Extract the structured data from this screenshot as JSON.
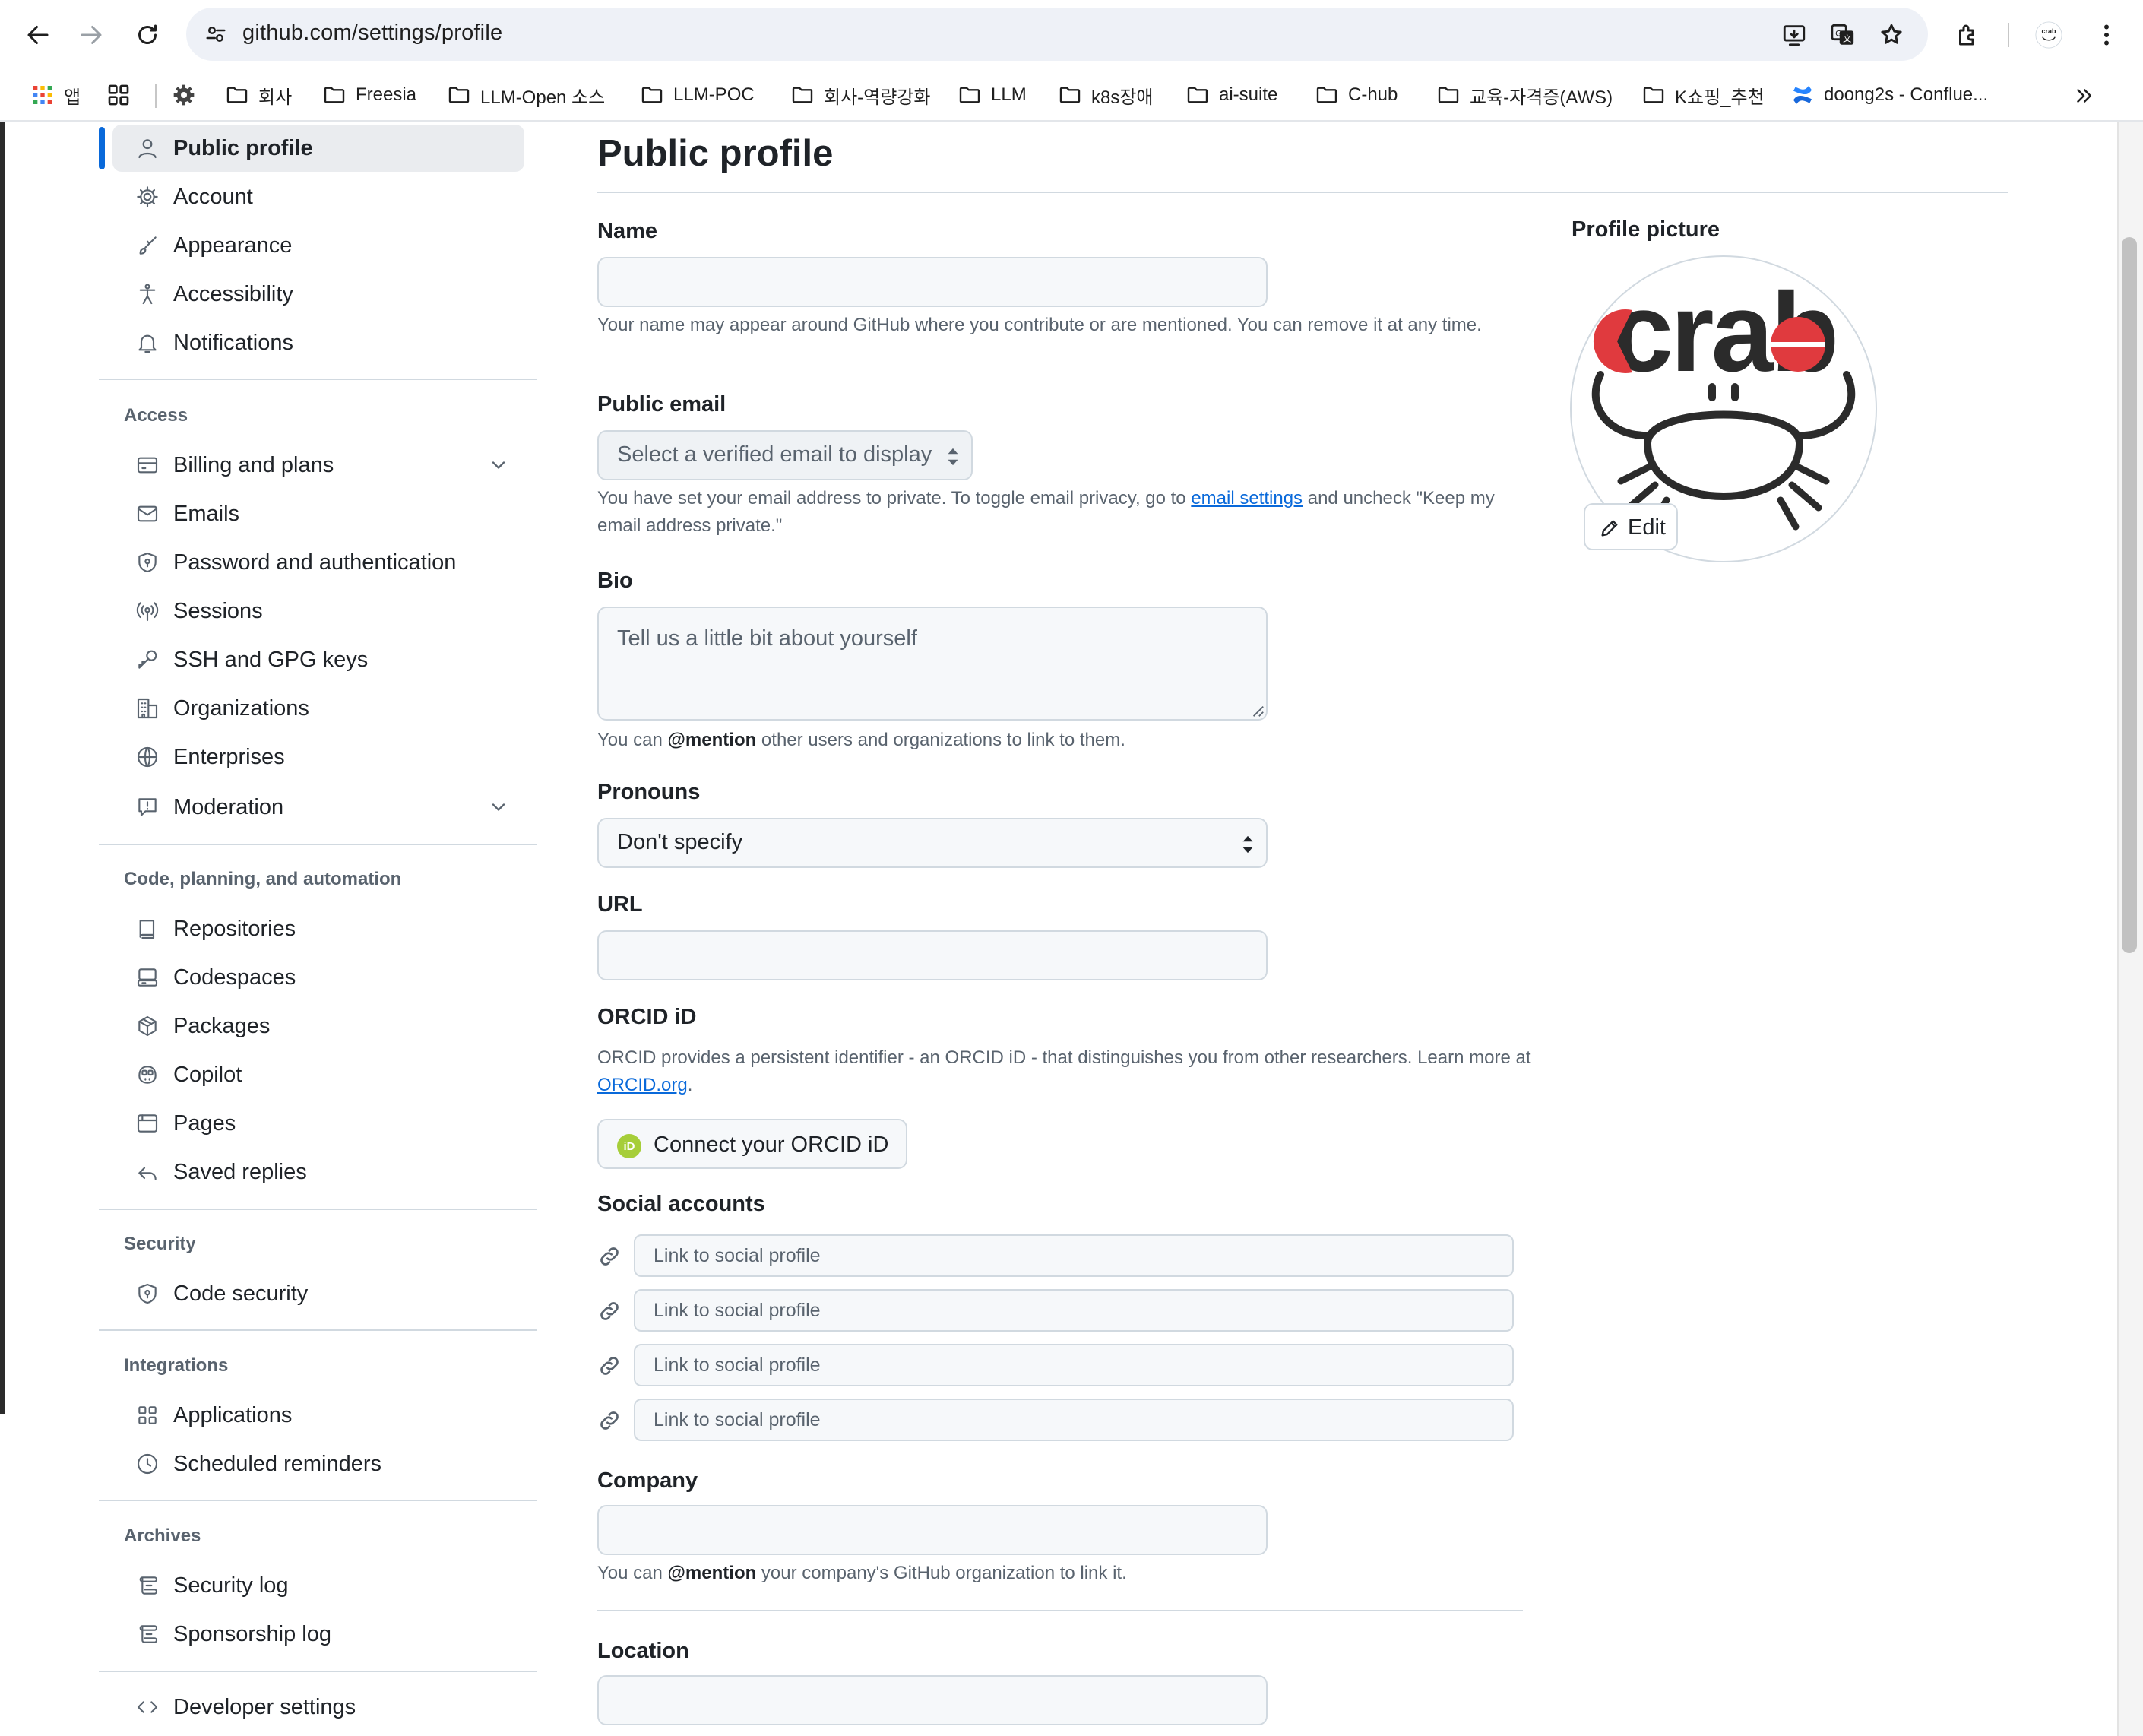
{
  "browser": {
    "url": "github.com/settings/profile",
    "bookmarks": [
      {
        "label": "앱",
        "icon": "apps-grid-icon"
      },
      {
        "label": "",
        "icon": "tab-groups-icon"
      },
      {
        "label": "",
        "icon": "gear-icon"
      },
      {
        "label": "회사",
        "icon": "folder-icon"
      },
      {
        "label": "Freesia",
        "icon": "folder-icon"
      },
      {
        "label": "LLM-Open 소스",
        "icon": "folder-icon"
      },
      {
        "label": "LLM-POC",
        "icon": "folder-icon"
      },
      {
        "label": "회사-역량강화",
        "icon": "folder-icon"
      },
      {
        "label": "LLM",
        "icon": "folder-icon"
      },
      {
        "label": "k8s장애",
        "icon": "folder-icon"
      },
      {
        "label": "ai-suite",
        "icon": "folder-icon"
      },
      {
        "label": "C-hub",
        "icon": "folder-icon"
      },
      {
        "label": "교육-자격증(AWS)",
        "icon": "folder-icon"
      },
      {
        "label": "K쇼핑_추천",
        "icon": "folder-icon"
      },
      {
        "label": "doong2s - Conflue...",
        "icon": "confluence-icon"
      }
    ]
  },
  "sidebar": {
    "top_items": [
      {
        "label": "Public profile",
        "icon": "person-icon",
        "active": true
      },
      {
        "label": "Account",
        "icon": "gear-icon"
      },
      {
        "label": "Appearance",
        "icon": "paintbrush-icon"
      },
      {
        "label": "Accessibility",
        "icon": "accessibility-icon"
      },
      {
        "label": "Notifications",
        "icon": "bell-icon"
      }
    ],
    "sections": [
      {
        "heading": "Access",
        "items": [
          {
            "label": "Billing and plans",
            "icon": "credit-card-icon",
            "expandable": true
          },
          {
            "label": "Emails",
            "icon": "mail-icon"
          },
          {
            "label": "Password and authentication",
            "icon": "shield-lock-icon"
          },
          {
            "label": "Sessions",
            "icon": "broadcast-icon"
          },
          {
            "label": "SSH and GPG keys",
            "icon": "key-icon"
          },
          {
            "label": "Organizations",
            "icon": "organization-icon"
          },
          {
            "label": "Enterprises",
            "icon": "globe-icon"
          },
          {
            "label": "Moderation",
            "icon": "report-icon",
            "expandable": true
          }
        ]
      },
      {
        "heading": "Code, planning, and automation",
        "items": [
          {
            "label": "Repositories",
            "icon": "repo-icon"
          },
          {
            "label": "Codespaces",
            "icon": "codespaces-icon"
          },
          {
            "label": "Packages",
            "icon": "package-icon"
          },
          {
            "label": "Copilot",
            "icon": "copilot-icon"
          },
          {
            "label": "Pages",
            "icon": "browser-icon"
          },
          {
            "label": "Saved replies",
            "icon": "reply-icon"
          }
        ]
      },
      {
        "heading": "Security",
        "items": [
          {
            "label": "Code security",
            "icon": "shield-lock-icon"
          }
        ]
      },
      {
        "heading": "Integrations",
        "items": [
          {
            "label": "Applications",
            "icon": "apps-icon"
          },
          {
            "label": "Scheduled reminders",
            "icon": "clock-icon"
          }
        ]
      },
      {
        "heading": "Archives",
        "items": [
          {
            "label": "Security log",
            "icon": "log-icon"
          },
          {
            "label": "Sponsorship log",
            "icon": "log-icon"
          }
        ]
      }
    ],
    "bottom_item": {
      "label": "Developer settings",
      "icon": "code-icon"
    }
  },
  "main": {
    "title": "Public profile",
    "name": {
      "label": "Name",
      "value": "",
      "note": "Your name may appear around GitHub where you contribute or are mentioned. You can remove it at any time."
    },
    "public_email": {
      "label": "Public email",
      "selected": "Select a verified email to display",
      "note_before": "You have set your email address to private. To toggle email privacy, go to ",
      "note_link": "email settings",
      "note_after": " and uncheck \"Keep my email address private.\""
    },
    "bio": {
      "label": "Bio",
      "placeholder": "Tell us a little bit about yourself",
      "note_before": "You can ",
      "note_mention": "@mention",
      "note_after": " other users and organizations to link to them."
    },
    "pronouns": {
      "label": "Pronouns",
      "selected": "Don't specify"
    },
    "url": {
      "label": "URL",
      "value": ""
    },
    "orcid": {
      "label": "ORCID iD",
      "note_before": "ORCID provides a persistent identifier - an ORCID iD - that distinguishes you from other researchers. Learn more at ",
      "note_link": "ORCID.org",
      "note_after": ".",
      "button": "Connect your ORCID iD",
      "badge": "iD",
      "badge_color": "#a6ce39"
    },
    "social": {
      "label": "Social accounts",
      "placeholder": "Link to social profile"
    },
    "company": {
      "label": "Company",
      "value": "",
      "note_before": "You can ",
      "note_mention": "@mention",
      "note_after": " your company's GitHub organization to link it."
    },
    "location": {
      "label": "Location",
      "value": ""
    },
    "profile_picture": {
      "label": "Profile picture",
      "logo_text": "crab",
      "edit_button": "Edit",
      "logo_red": "#e03a3e"
    }
  },
  "colors": {
    "accent": "#0969da",
    "muted_text": "#59636e",
    "border": "#d1d9e0",
    "input_bg": "#f6f8fa"
  }
}
